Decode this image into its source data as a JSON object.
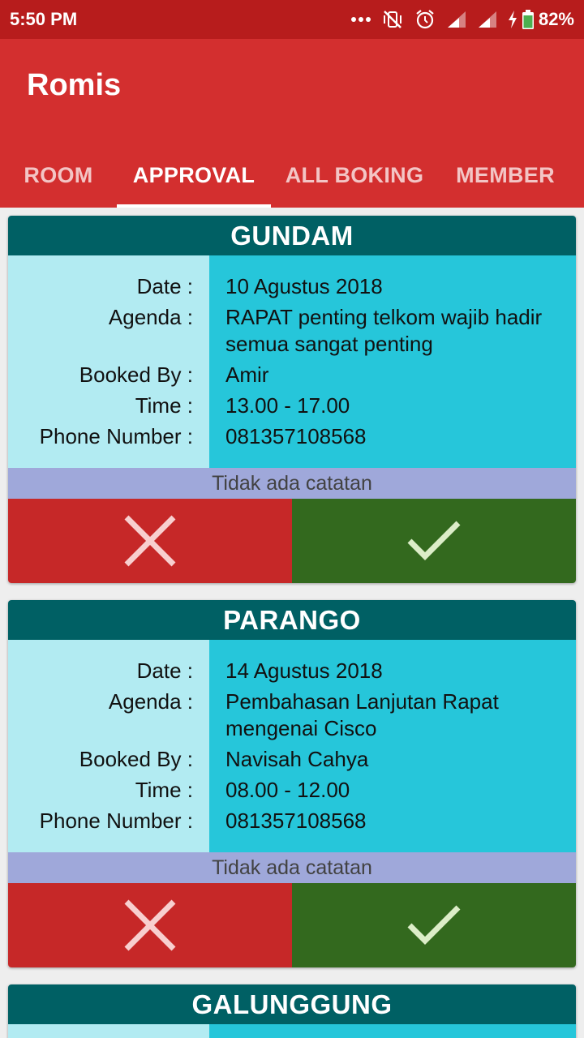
{
  "status_bar": {
    "time": "5:50 PM",
    "battery": "82%",
    "icons": [
      "more-dots-icon",
      "vibrate-off-icon",
      "alarm-icon",
      "signal-icon",
      "signal-icon",
      "charging-icon",
      "battery-icon"
    ]
  },
  "app": {
    "title": "Romis",
    "colors": {
      "primary": "#d32f2f",
      "primary_dark": "#b71c1c",
      "card_header": "#006064",
      "label_bg": "#b2ebf2",
      "value_bg": "#26c6da",
      "note_bg": "#9fa8da",
      "reject": "#c62828",
      "approve": "#33691e"
    }
  },
  "tabs": [
    {
      "label": "ROOM",
      "active": false
    },
    {
      "label": "APPROVAL",
      "active": true
    },
    {
      "label": "ALL BOKING",
      "active": false
    },
    {
      "label": "MEMBER",
      "active": false
    }
  ],
  "labels": {
    "date": "Date :",
    "agenda": "Agenda :",
    "booked_by": "Booked By :",
    "time": "Time :",
    "phone": "Phone Number :"
  },
  "bookings": [
    {
      "room": "GUNDAM",
      "date": "10 Agustus 2018",
      "agenda": "RAPAT penting telkom wajib hadir semua sangat penting",
      "booked_by": "Amir",
      "time": "13.00 - 17.00",
      "phone": "081357108568",
      "note": "Tidak ada catatan",
      "reject_icon": "close-icon",
      "approve_icon": "check-icon"
    },
    {
      "room": "PARANGO",
      "date": "14 Agustus 2018",
      "agenda": "Pembahasan Lanjutan Rapat mengenai Cisco",
      "booked_by": "Navisah Cahya",
      "time": "08.00 - 12.00",
      "phone": "081357108568",
      "note": "Tidak ada catatan",
      "reject_icon": "close-icon",
      "approve_icon": "check-icon"
    },
    {
      "room": "GALUNGGUNG"
    }
  ]
}
